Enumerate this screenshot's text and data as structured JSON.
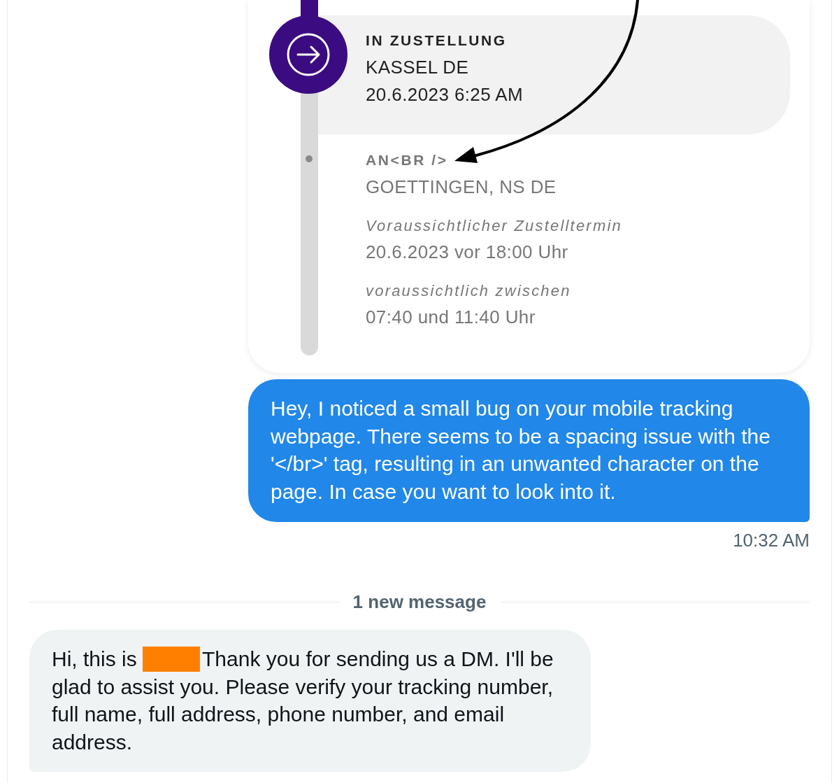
{
  "tracking_card": {
    "events": [
      {
        "current": true,
        "status": "IN ZUSTELLUNG",
        "location": "KASSEL DE",
        "timestamp": "20.6.2023 6:25 AM"
      },
      {
        "current": false,
        "status": "AN<BR />",
        "location": "GOETTINGEN, NS DE",
        "details": [
          {
            "label": "Voraussichtlicher Zustelltermin",
            "value": "20.6.2023 vor 18:00 Uhr"
          },
          {
            "label": "voraussichtlich zwischen",
            "value": "07:40 und 11:40 Uhr"
          }
        ]
      }
    ]
  },
  "sent_message": {
    "text": "Hey, I noticed a small bug on your mobile tracking webpage. There seems to be a spacing issue with the '</br>' tag, resulting in an unwanted character on the page. In case you want to look into it.",
    "time": "10:32 AM"
  },
  "divider": {
    "label": "1 new message"
  },
  "received_message": {
    "text_start": "Hi, this is",
    "redacted": true,
    "text_end": "Thank you for sending us a DM. I'll be glad to assist you. Please verify your tracking number, full name, full address, phone number, and email address."
  }
}
